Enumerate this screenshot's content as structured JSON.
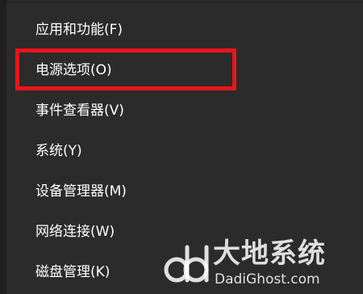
{
  "menu": {
    "items": [
      {
        "label": "应用和功能(F)"
      },
      {
        "label": "电源选项(O)"
      },
      {
        "label": "事件查看器(V)"
      },
      {
        "label": "系统(Y)"
      },
      {
        "label": "设备管理器(M)"
      },
      {
        "label": "网络连接(W)"
      },
      {
        "label": "磁盘管理(K)"
      }
    ]
  },
  "watermark": {
    "title": "大地系统",
    "url": "DadiGhost.com"
  },
  "colors": {
    "menu_background": "#2b2b2b",
    "text": "#ffffff",
    "highlight_border": "#e8151a"
  }
}
